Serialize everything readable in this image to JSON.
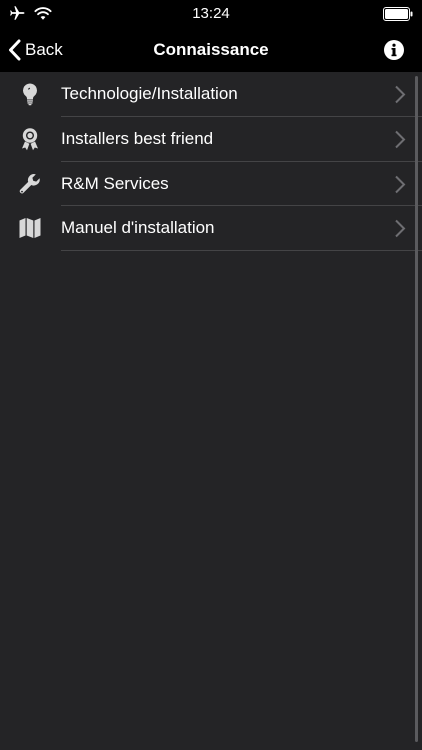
{
  "status_bar": {
    "time": "13:24",
    "icons": [
      "airplane-icon",
      "wifi-icon",
      "battery-icon"
    ]
  },
  "nav": {
    "back_label": "Back",
    "title": "Connaissance",
    "info_icon": "info-icon"
  },
  "items": [
    {
      "label": "Technologie/Installation",
      "icon": "lightbulb-icon"
    },
    {
      "label": "Installers best friend",
      "icon": "award-icon"
    },
    {
      "label": "R&M Services",
      "icon": "wrench-icon"
    },
    {
      "label": "Manuel d'installation",
      "icon": "map-icon"
    }
  ],
  "colors": {
    "background": "#242426",
    "bar": "#000000",
    "separator": "#444446",
    "icon": "#d8d8d8",
    "chevron": "#6e6e72"
  }
}
